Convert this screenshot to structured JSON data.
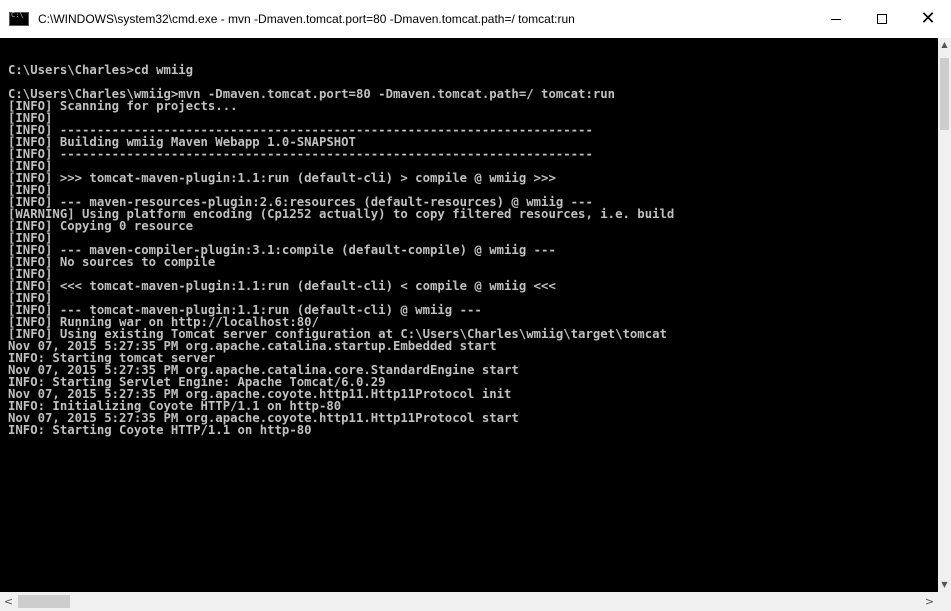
{
  "window": {
    "title": "C:\\WINDOWS\\system32\\cmd.exe - mvn  -Dmaven.tomcat.port=80 -Dmaven.tomcat.path=/ tomcat:run",
    "icon": "cmd-icon",
    "controls": {
      "minimize": "minimize-icon",
      "maximize": "maximize-icon",
      "close": "close-icon",
      "close_glyph": "✕"
    }
  },
  "console": {
    "text_color": "#c0c0c0",
    "background": "#000000",
    "lines": [
      "C:\\Users\\Charles>cd wmiig",
      "",
      "C:\\Users\\Charles\\wmiig>mvn -Dmaven.tomcat.port=80 -Dmaven.tomcat.path=/ tomcat:run",
      "[INFO] Scanning for projects...",
      "[INFO]",
      "[INFO] ------------------------------------------------------------------------",
      "[INFO] Building wmiig Maven Webapp 1.0-SNAPSHOT",
      "[INFO] ------------------------------------------------------------------------",
      "[INFO]",
      "[INFO] >>> tomcat-maven-plugin:1.1:run (default-cli) > compile @ wmiig >>>",
      "[INFO]",
      "[INFO] --- maven-resources-plugin:2.6:resources (default-resources) @ wmiig ---",
      "[WARNING] Using platform encoding (Cp1252 actually) to copy filtered resources, i.e. build",
      "[INFO] Copying 0 resource",
      "[INFO]",
      "[INFO] --- maven-compiler-plugin:3.1:compile (default-compile) @ wmiig ---",
      "[INFO] No sources to compile",
      "[INFO]",
      "[INFO] <<< tomcat-maven-plugin:1.1:run (default-cli) < compile @ wmiig <<<",
      "[INFO]",
      "[INFO] --- tomcat-maven-plugin:1.1:run (default-cli) @ wmiig ---",
      "[INFO] Running war on http://localhost:80/",
      "[INFO] Using existing Tomcat server configuration at C:\\Users\\Charles\\wmiig\\target\\tomcat",
      "Nov 07, 2015 5:27:35 PM org.apache.catalina.startup.Embedded start",
      "INFO: Starting tomcat server",
      "Nov 07, 2015 5:27:35 PM org.apache.catalina.core.StandardEngine start",
      "INFO: Starting Servlet Engine: Apache Tomcat/6.0.29",
      "Nov 07, 2015 5:27:35 PM org.apache.coyote.http11.Http11Protocol init",
      "INFO: Initializing Coyote HTTP/1.1 on http-80",
      "Nov 07, 2015 5:27:35 PM org.apache.coyote.http11.Http11Protocol start",
      "INFO: Starting Coyote HTTP/1.1 on http-80"
    ]
  },
  "scrollbars": {
    "up_arrow": "▲",
    "down_arrow": "▼",
    "left_arrow": "<",
    "right_arrow": ">"
  }
}
